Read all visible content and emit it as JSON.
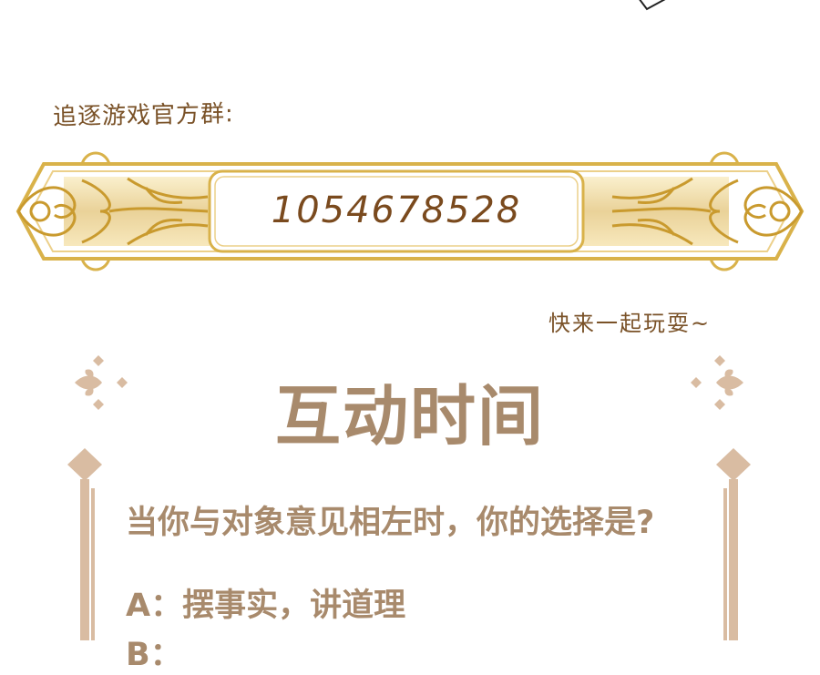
{
  "group": {
    "caption": "追逐游戏官方群:",
    "number": "1054678528",
    "invite": "快来一起玩耍~"
  },
  "interaction": {
    "title": "互动时间",
    "question": "当你与对象意见相左时，你的选择是?",
    "options": [
      {
        "label": "A：摆事实，讲道理"
      },
      {
        "label": "B："
      }
    ]
  },
  "colors": {
    "gold": "#d9b24a",
    "gold_light": "#f3dc95",
    "brown_text": "#7a5228",
    "title_tan": "#a88a6c",
    "ornament_tan": "#d9bca2"
  }
}
